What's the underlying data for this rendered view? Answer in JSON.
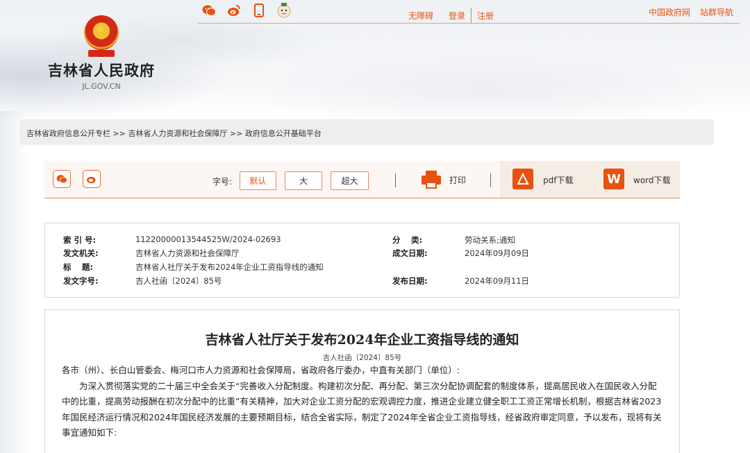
{
  "header": {
    "accessibility": "无障碍",
    "login": "登录",
    "register": "注册",
    "gov_link": "中国政府网",
    "site_nav": "站群导航",
    "icons": [
      "weixin-icon",
      "weibo-icon",
      "mobile-icon",
      "mascot-icon"
    ]
  },
  "logo": {
    "name": "吉林省人民政府",
    "domain": "JL.GOV.CN"
  },
  "breadcrumb": "吉林省政府信息公开专栏 >> 吉林省人力资源和社会保障厅 >> 政府信息公开基础平台",
  "toolbar": {
    "font_label": "字号:",
    "font_default": "默认",
    "font_large": "大",
    "font_xlarge": "超大",
    "print": "打印",
    "pdf": "pdf下载",
    "word": "word下载"
  },
  "meta": {
    "index_label": "索 引 号:",
    "index_value": "11220000013544525W/2024-02693",
    "category_label": "分　 类:",
    "category_value": "劳动关系;通知",
    "issuer_label": "发文机关:",
    "issuer_value": "吉林省人力资源和社会保障厅",
    "created_label": "成文日期:",
    "created_value": "2024年09月09日",
    "title_label": "标　 题:",
    "title_value": "吉林省人社厅关于发布2024年企业工资指导线的通知",
    "docno_label": "发文字号:",
    "docno_value": "吉人社函〔2024〕85号",
    "published_label": "发布日期:",
    "published_value": "2024年09月11日"
  },
  "article": {
    "title": "吉林省人社厅关于发布2024年企业工资指导线的通知",
    "doc_number": "吉人社函〔2024〕85号",
    "salutation": "各市（州）、长白山管委会、梅河口市人力资源和社会保障局，省政府各厅委办，中直有关部门（单位）:",
    "para1": "为深入贯彻落实党的二十届三中全会关于“完善收入分配制度。构建初次分配、再分配、第三次分配协调配套的制度体系，提高居民收入在国民收入分配中的比重，提高劳动报酬在初次分配中的比重”有关精神，加大对企业工资分配的宏观调控力度，推进企业建立健全职工工资正常增长机制，根据吉林省2023年国民经济运行情况和2024年国民经济发展的主要预期目标，结合全省实际，制定了2024年全省企业工资指导线，经省政府审定同意，予以发布，现将有关事宜通知如下:"
  },
  "colors": {
    "accent": "#e8520f",
    "breadcrumb_bg": "#eeeeee",
    "toolbar_bg": "#fcf7f3"
  }
}
